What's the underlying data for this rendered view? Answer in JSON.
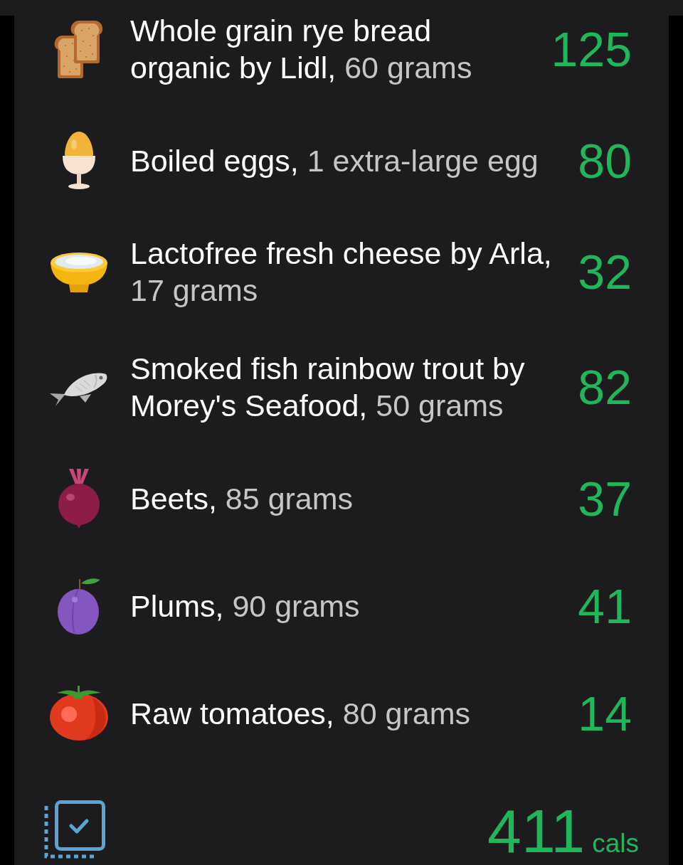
{
  "foods": [
    {
      "kind": "bread",
      "name": "Whole grain rye bread organic by Lidl,",
      "portion": "60 grams",
      "calories": "125"
    },
    {
      "kind": "egg",
      "name": "Boiled eggs,",
      "portion": "1 extra-large egg",
      "calories": "80"
    },
    {
      "kind": "cheese",
      "name": "Lactofree fresh cheese by Arla,",
      "portion": "17 grams",
      "calories": "32"
    },
    {
      "kind": "fish",
      "name": "Smoked fish rainbow trout by Morey's Seafood,",
      "portion": "50 grams",
      "calories": "82"
    },
    {
      "kind": "beet",
      "name": "Beets,",
      "portion": "85 grams",
      "calories": "37"
    },
    {
      "kind": "plum",
      "name": "Plums,",
      "portion": "90 grams",
      "calories": "41"
    },
    {
      "kind": "tomato",
      "name": "Raw tomatoes,",
      "portion": "80 grams",
      "calories": "14"
    }
  ],
  "total": {
    "calories": "411",
    "unit": "cals"
  }
}
